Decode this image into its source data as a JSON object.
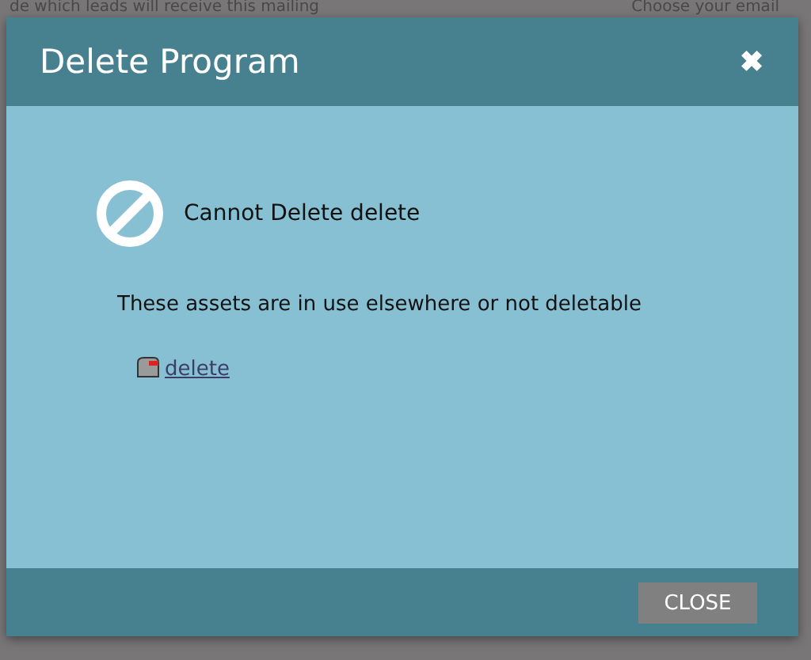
{
  "background": {
    "texts": [
      "de which leads will receive this mailing",
      "Choose your email"
    ]
  },
  "dialog": {
    "title": "Delete Program",
    "close_icon": "✖",
    "message": "Cannot Delete delete",
    "description": "These assets are in use elsewhere or not deletable",
    "assets": [
      {
        "name": "delete"
      }
    ],
    "buttons": [
      "CLOSE"
    ]
  }
}
